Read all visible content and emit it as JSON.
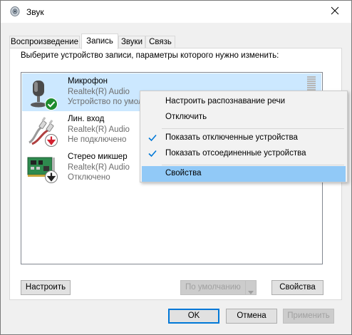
{
  "window": {
    "title": "Звук"
  },
  "tabs": [
    {
      "label": "Воспроизведение"
    },
    {
      "label": "Запись"
    },
    {
      "label": "Звуки"
    },
    {
      "label": "Связь"
    }
  ],
  "panel": {
    "instruction": "Выберите устройство записи, параметры которого нужно изменить:"
  },
  "devices": [
    {
      "name": "Микрофон",
      "driver": "Realtek(R) Audio",
      "status": "Устройство по умолчанию",
      "status_visible": "Устройство по умол",
      "badge": "check-badge-icon"
    },
    {
      "name": "Лин. вход",
      "driver": "Realtek(R) Audio",
      "status": "Не подключено",
      "badge": "down-arrow-red-badge-icon"
    },
    {
      "name": "Стерео микшер",
      "driver": "Realtek(R) Audio",
      "status": "Отключено",
      "badge": "down-arrow-black-badge-icon"
    }
  ],
  "context_menu": {
    "items": [
      {
        "label": "Настроить распознавание речи",
        "checked": false
      },
      {
        "label": "Отключить",
        "checked": false
      },
      {
        "label": "Показать отключенные устройства",
        "checked": true
      },
      {
        "label": "Показать отсоединенные устройства",
        "checked": true
      },
      {
        "label": "Свойства",
        "checked": false,
        "highlighted": true
      }
    ]
  },
  "panel_buttons": {
    "configure": "Настроить",
    "set_default": "По умолчанию",
    "properties": "Свойства"
  },
  "dialog_buttons": {
    "ok": "OK",
    "cancel": "Отмена",
    "apply": "Применить"
  },
  "colors": {
    "accent": "#0078d7",
    "selection": "#cce8ff",
    "menu_highlight": "#91c9f7",
    "check_green": "#1e8c2e",
    "arrow_red": "#d2202f"
  }
}
